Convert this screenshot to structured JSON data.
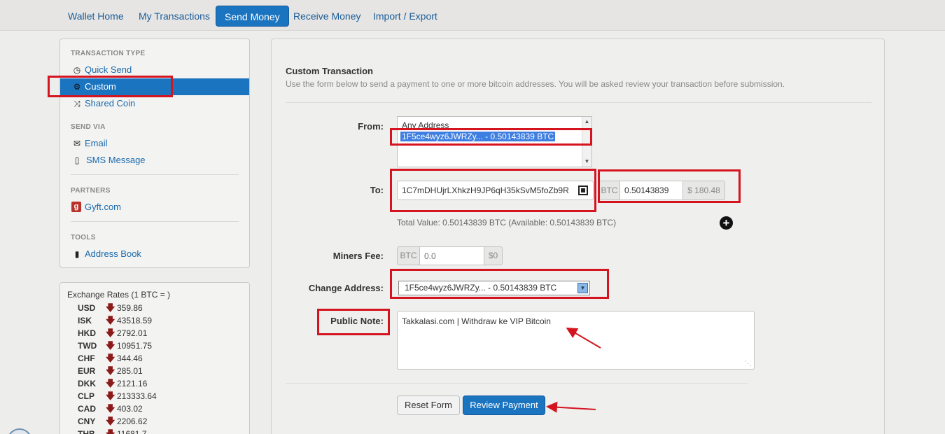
{
  "nav": {
    "tabs": [
      "Wallet Home",
      "My Transactions",
      "Send Money",
      "Receive Money",
      "Import / Export"
    ],
    "active": "Send Money"
  },
  "sidebar": {
    "transaction_type_heading": "TRANSACTION TYPE",
    "quick_send": "Quick Send",
    "custom": "Custom",
    "shared_coin": "Shared Coin",
    "send_via_heading": "SEND VIA",
    "email": "Email",
    "sms": "SMS Message",
    "partners_heading": "PARTNERS",
    "gyft": "Gyft.com",
    "gyft_badge": "g",
    "tools_heading": "TOOLS",
    "address_book": "Address Book"
  },
  "rates": {
    "title": "Exchange Rates (1 BTC = )",
    "items": [
      {
        "code": "USD",
        "value": "359.86"
      },
      {
        "code": "ISK",
        "value": "43518.59"
      },
      {
        "code": "HKD",
        "value": "2792.01"
      },
      {
        "code": "TWD",
        "value": "10951.75"
      },
      {
        "code": "CHF",
        "value": "344.46"
      },
      {
        "code": "EUR",
        "value": "285.01"
      },
      {
        "code": "DKK",
        "value": "2121.16"
      },
      {
        "code": "CLP",
        "value": "213333.64"
      },
      {
        "code": "CAD",
        "value": "403.02"
      },
      {
        "code": "CNY",
        "value": "2206.62"
      },
      {
        "code": "THB",
        "value": "11681.7"
      }
    ]
  },
  "form": {
    "title": "Custom Transaction",
    "subtitle": "Use the form below to send a payment to one or more bitcoin addresses. You will be asked review your transaction before submission.",
    "from_label": "From:",
    "from_options": [
      "Any Address",
      "1F5ce4wyz6JWRZy... - 0.50143839 BTC"
    ],
    "to_label": "To:",
    "to_address": "1C7mDHUjrLXhkzH9JP6qH35kSvM5foZb9R",
    "btc_addon": "BTC",
    "amount": "0.50143839",
    "usd_value": "$ 180.48",
    "total_value": "Total Value: 0.50143839 BTC (Available: 0.50143839 BTC)",
    "miners_fee_label": "Miners Fee:",
    "fee_btc_addon": "BTC",
    "fee_placeholder": "0.0",
    "fee_usd": "$0",
    "change_label": "Change Address:",
    "change_value": "1F5ce4wyz6JWRZy... - 0.50143839 BTC",
    "note_label": "Public Note:",
    "note_value": "Takkalasi.com | Withdraw ke VIP Bitcoin",
    "reset_button": "Reset Form",
    "review_button": "Review Payment"
  },
  "colors": {
    "accent": "#1b74c0",
    "highlight": "#d4141f",
    "down_arrow": "#8b1a1a"
  }
}
